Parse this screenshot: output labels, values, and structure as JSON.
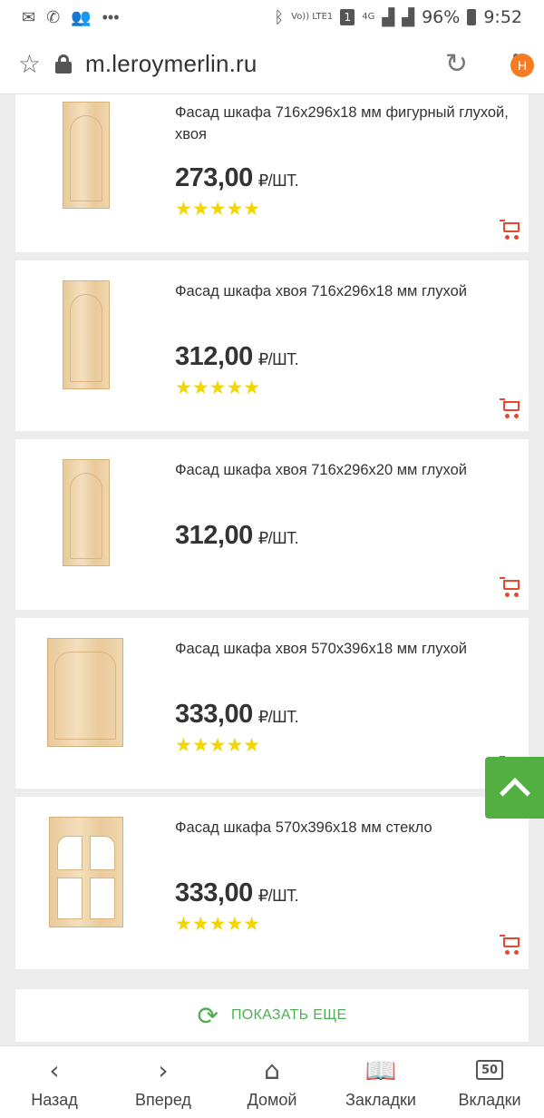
{
  "status_bar": {
    "battery": "96%",
    "time": "9:52",
    "network": "4G",
    "volte": "Vo)) LTE1",
    "sim": "1"
  },
  "browser": {
    "url": "m.leroymerlin.ru",
    "profile_badge": "Н"
  },
  "products": [
    {
      "title": "Фасад шкафа 716x296x18 мм фигурный глухой, хвоя",
      "price": "273,00",
      "unit": "₽/ШТ.",
      "rating": "★★★★★"
    },
    {
      "title": "Фасад шкафа хвоя 716x296x18 мм глухой",
      "price": "312,00",
      "unit": "₽/ШТ.",
      "rating": "★★★★★"
    },
    {
      "title": "Фасад шкафа хвоя 716x296x20 мм глухой",
      "price": "312,00",
      "unit": "₽/ШТ.",
      "rating": ""
    },
    {
      "title": "Фасад шкафа хвоя 570x396x18 мм глухой",
      "price": "333,00",
      "unit": "₽/ШТ.",
      "rating": "★★★★★"
    },
    {
      "title": "Фасад шкафа 570x396x18 мм стекло",
      "price": "333,00",
      "unit": "₽/ШТ.",
      "rating": "★★★★★"
    }
  ],
  "show_more": "ПОКАЗАТЬ ЕЩЕ",
  "bottom_nav": {
    "back": "Назад",
    "forward": "Вперед",
    "home": "Домой",
    "bookmarks": "Закладки",
    "tabs": "Вкладки",
    "tabs_count": "50"
  },
  "colors": {
    "accent_green": "#52b043",
    "cart_red": "#e8472b",
    "star_yellow": "#f2d600",
    "badge_orange": "#f57c20"
  }
}
